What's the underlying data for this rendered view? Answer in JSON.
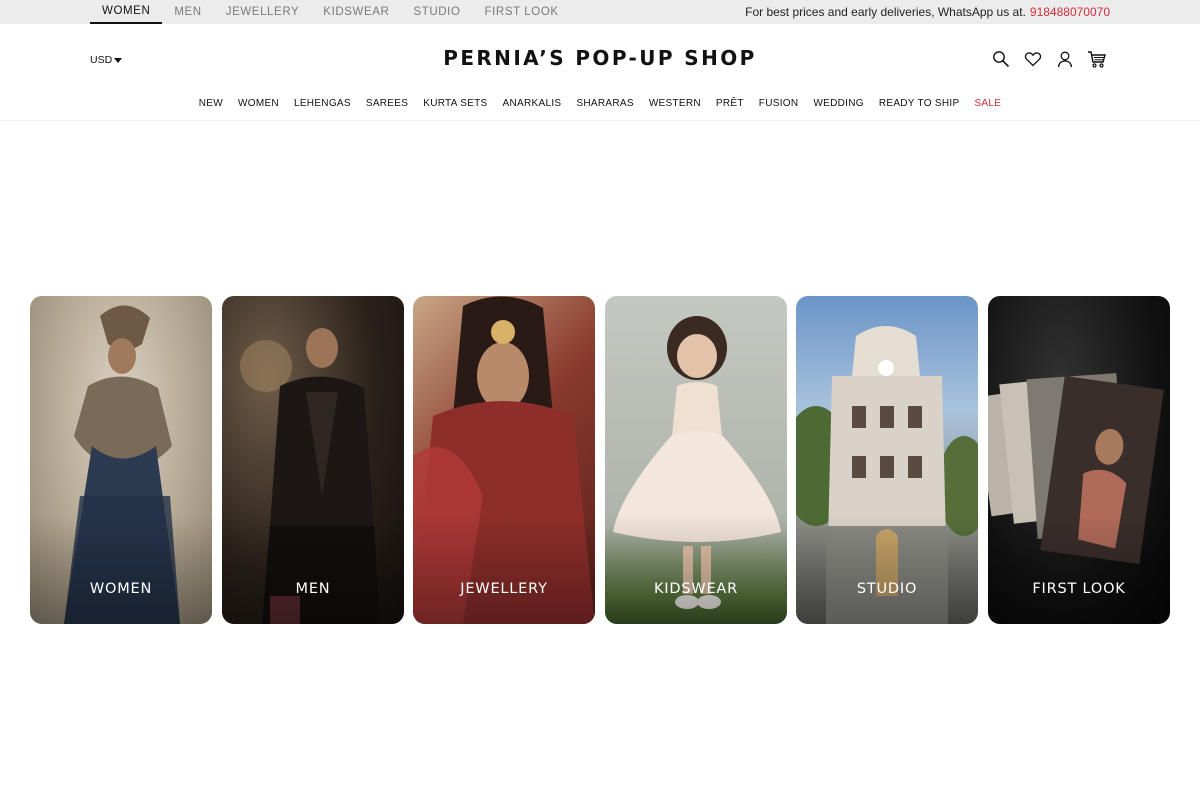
{
  "top_bar": {
    "tabs": [
      {
        "label": "WOMEN",
        "active": true
      },
      {
        "label": "MEN",
        "active": false
      },
      {
        "label": "JEWELLERY",
        "active": false
      },
      {
        "label": "KIDSWEAR",
        "active": false
      },
      {
        "label": "STUDIO",
        "active": false
      },
      {
        "label": "FIRST LOOK",
        "active": false
      }
    ],
    "promo_text": "For best prices and early deliveries, WhatsApp us at.",
    "promo_phone": "918488070070",
    "promo_phone_color": "#d12e3c"
  },
  "header": {
    "currency": "USD",
    "logo": "PERNIA’S POP-UP SHOP",
    "icons": [
      "search-icon",
      "wishlist-heart-icon",
      "account-user-icon",
      "cart-icon"
    ]
  },
  "nav": {
    "items": [
      "NEW",
      "WOMEN",
      "LEHENGAS",
      "SAREES",
      "KURTA SETS",
      "ANARKALIS",
      "SHARARAS",
      "WESTERN",
      "PRÊT",
      "FUSION",
      "WEDDING",
      "READY TO SHIP",
      "SALE"
    ],
    "sale_color": "#d12e3c"
  },
  "categories": [
    {
      "label": "WOMEN"
    },
    {
      "label": "MEN"
    },
    {
      "label": "JEWELLERY"
    },
    {
      "label": "KIDSWEAR"
    },
    {
      "label": "STUDIO"
    },
    {
      "label": "FIRST LOOK"
    }
  ]
}
